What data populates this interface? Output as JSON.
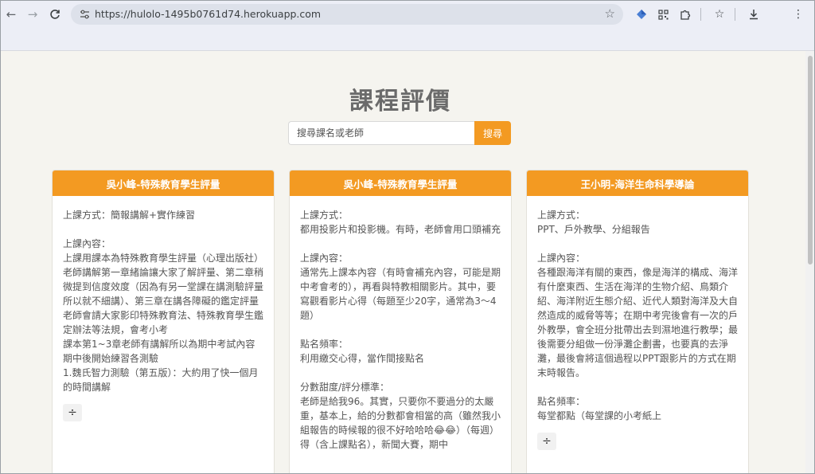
{
  "browser": {
    "url": "https://hulolo-1495b0761d74.herokuapp.com",
    "icons": {
      "back": "arrow-left-icon",
      "forward": "arrow-right-icon",
      "reload": "reload-icon",
      "site_info": "tune-icon",
      "bookmark": "star-icon",
      "extension1": "diamond-extension-icon",
      "extension2": "qr-extension-icon",
      "extensions": "puzzle-icon",
      "bookmarks_list": "star-list-icon",
      "downloads": "download-icon",
      "menu": "kebab-menu-icon"
    }
  },
  "page": {
    "title": "課程評價",
    "search": {
      "placeholder": "搜尋課名或老師",
      "value": "",
      "button_label": "搜尋"
    },
    "accent_color": "#f39a22",
    "expand_icon": "vertical-expand-icon"
  },
  "cards": [
    {
      "title": "吳小峰-特殊教育學生評量",
      "paragraphs": [
        "上課方式：簡報講解+實作練習",
        "上課內容：\n上課用課本為特殊教育學生評量（心理出版社）\n老師講解第一章緒論讓大家了解評量、第二章稍微提到信度效度（因為有另一堂課在講測驗評量所以就不細講）、第三章在講各障礙的鑑定評量老師會請大家影印特殊教育法、特殊教育學生鑑定辦法等法規，會考小考\n課本第1~3章老師有講解所以為期中考試內容\n期中後開始練習各測驗\n1.魏氏智力測驗（第五版）：大約用了快一個月的時間講解"
      ]
    },
    {
      "title": "吳小峰-特殊教育學生評量",
      "paragraphs": [
        "上課方式：\n都用投影片和投影機。有時，老師會用口頭補充",
        "上課內容：\n通常先上課本內容（有時會補充內容，可能是期中考會考的），再看與特教相關影片。其中，要寫觀看影片心得（每題至少20字，通常為3～4題）",
        "點名頻率：\n利用繳交心得，當作間接點名",
        "分數甜度/評分標準：\n老師是給我96。其實，只要你不要過分的太嚴重，基本上，給的分數都會相當的高（雖然我小組報告的時候報的很不好哈哈哈😂😂）（每週）得（含上課點名），新聞大賽，期中"
      ]
    },
    {
      "title": "王小明-海洋生命科學導論",
      "paragraphs": [
        "上課方式：\nPPT、戶外教學、分組報告",
        "上課內容：\n各種跟海洋有關的東西，像是海洋的構成、海洋有什麼東西、生活在海洋的生物介紹、鳥類介紹、海洋附近生態介紹、近代人類對海洋及大自然造成的威脅等等；在期中考完後會有一次的戶外教學，會全班分批帶出去到濕地進行教學；最後需要分組做一份淨灘企劃書，也要真的去淨灘，最後會將這個過程以PPT跟影片的方式在期末時報告。",
        "點名頻率：\n每堂都點（每堂課的小考紙上"
      ]
    }
  ]
}
